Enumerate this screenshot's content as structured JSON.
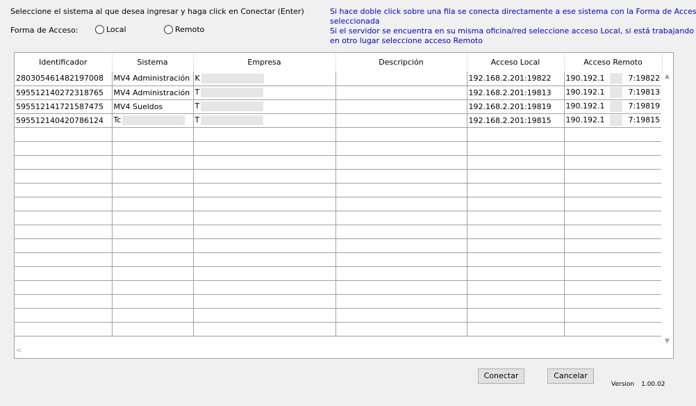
{
  "instructions": "Seleccione el sistema al que desea ingresar y haga click en Conectar (Enter)",
  "info": {
    "line1": "Si hace doble click sobre una fila se conecta directamente a ese sistema con la Forma de Acceso",
    "line2": "seleccionada",
    "line3": "Si el servidor se encuentra en su misma oficina/red seleccione acceso Local, si está trabajando",
    "line4": "en otro lugar seleccione acceso Remoto"
  },
  "access_form": {
    "label": "Forma de Acceso:",
    "local_label": "Local",
    "remote_label": "Remoto"
  },
  "grid": {
    "columns": [
      "Identificador",
      "Sistema",
      "Empresa",
      "Descripción",
      "Acceso Local",
      "Acceso Remoto"
    ],
    "rows": [
      {
        "identificador": "280305461482197008",
        "sistema": "MV4 Administración",
        "empresa": "K",
        "descripcion": "",
        "acceso_local": "192.168.2.201:19822",
        "acceso_remoto_a": "190.192.1",
        "acceso_remoto_b": "7:19822"
      },
      {
        "identificador": "595512140272318765",
        "sistema": "MV4 Administración",
        "empresa": "T",
        "descripcion": "",
        "acceso_local": "192.168.2.201:19813",
        "acceso_remoto_a": "190.192.1",
        "acceso_remoto_b": "7:19813"
      },
      {
        "identificador": "595512141721587475",
        "sistema": "MV4 Sueldos",
        "empresa": "T",
        "descripcion": "",
        "acceso_local": "192.168.2.201:19819",
        "acceso_remoto_a": "190.192.1",
        "acceso_remoto_b": "7:19819"
      },
      {
        "identificador": "595512140420786124",
        "sistema": "Tc",
        "empresa": "T",
        "descripcion": "",
        "acceso_local": "192.168.2.201:19815",
        "acceso_remoto_a": "190.192.1",
        "acceso_remoto_b": "7:19815"
      }
    ]
  },
  "buttons": {
    "connect": "Conectar",
    "cancel": "Cancelar"
  },
  "version": {
    "label": "Version",
    "value": "1.00.02"
  }
}
